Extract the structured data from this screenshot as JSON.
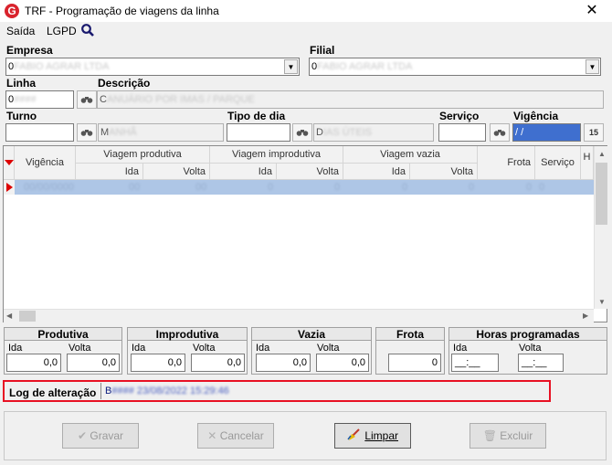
{
  "window": {
    "title": "TRF - Programação de viagens da linha",
    "close": "✕",
    "logo": "G"
  },
  "menu": {
    "items": [
      "Saída",
      "LGPD"
    ]
  },
  "form": {
    "empresa_label": "Empresa",
    "empresa_value": "0",
    "empresa_blur": "FABIO AGRAR LTDA",
    "filial_label": "Filial",
    "filial_value": "0",
    "filial_blur": "FABIO AGRAR LTDA",
    "linha_label": "Linha",
    "linha_value": "0",
    "linha_blur": "####",
    "descricao_label": "Descrição",
    "descricao_value": "C",
    "descricao_blur": "ANUÁRIO POR IMAS / PARQUE",
    "turno_label": "Turno",
    "turno_value": "",
    "turno_desc": "M",
    "turno_blur": "ANHÃ",
    "tipo_label": "Tipo de dia",
    "tipo_value": "",
    "tipo_desc": "D",
    "tipo_blur": "IAS ÚTEIS",
    "servico_label": "Serviço",
    "servico_value": "",
    "vigencia_label": "Vigência",
    "vigencia_value": " / /",
    "calendar_icon": "15"
  },
  "grid": {
    "headers": {
      "vigencia": "Vigência",
      "viagem_produtiva": "Viagem produtiva",
      "viagem_improdutiva": "Viagem improdutiva",
      "viagem_vazia": "Viagem vazia",
      "ida": "Ida",
      "volta": "Volta",
      "frota": "Frota",
      "servico": "Serviço",
      "h": "H"
    },
    "row": {
      "vigencia": "00/00/0000",
      "vals": [
        "00",
        "00",
        "0",
        "0",
        "0",
        "0",
        "0",
        "0"
      ]
    }
  },
  "totals": {
    "produtiva": {
      "title": "Produtiva",
      "ida_label": "Ida",
      "volta_label": "Volta",
      "ida": "0,0",
      "volta": "0,0"
    },
    "improdutiva": {
      "title": "Improdutiva",
      "ida_label": "Ida",
      "volta_label": "Volta",
      "ida": "0,0",
      "volta": "0,0"
    },
    "vazia": {
      "title": "Vazia",
      "ida_label": "Ida",
      "volta_label": "Volta",
      "ida": "0,0",
      "volta": "0,0"
    },
    "frota": {
      "title": "Frota",
      "value": "0"
    },
    "horas": {
      "title": "Horas programadas",
      "ida_label": "Ida",
      "volta_label": "Volta",
      "ida": "__:__",
      "volta": "__:__"
    }
  },
  "log": {
    "label": "Log de alteração",
    "value_prefix": "B",
    "value_blur": "####  23/08/2022 15:29:46"
  },
  "buttons": {
    "gravar": "Gravar",
    "cancelar": "Cancelar",
    "limpar": "Limpar",
    "excluir": "Excluir"
  },
  "colors": {
    "accent": "#e81123",
    "selection": "#aec6e6",
    "logo": "#d9232d"
  }
}
